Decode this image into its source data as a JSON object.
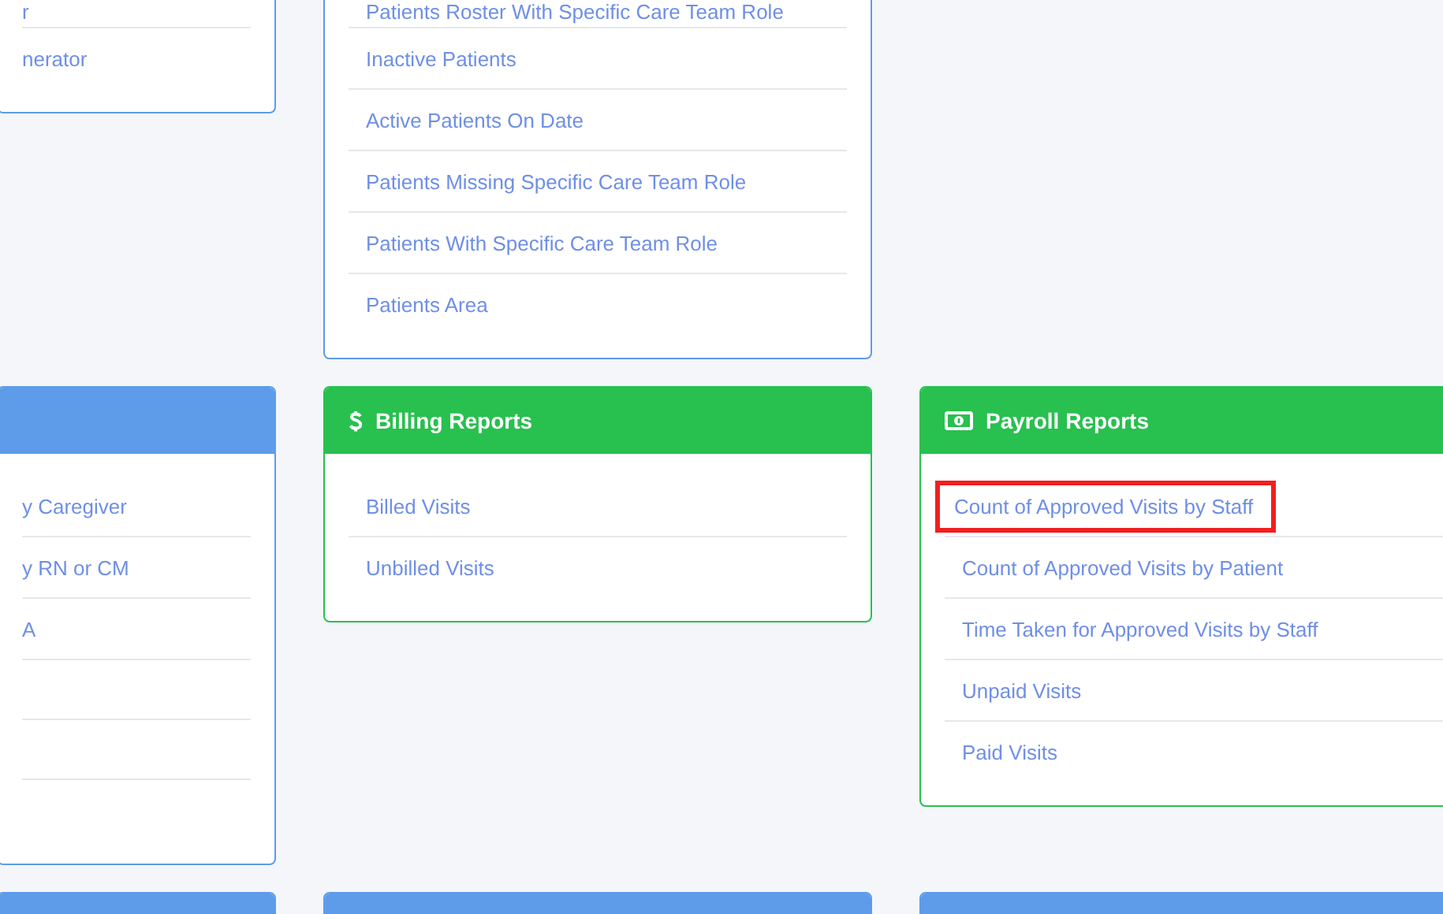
{
  "rows": [
    {
      "cards": [
        {
          "kind": "continued",
          "color": "#5e9cea",
          "items": [
            {
              "label": "r",
              "highlighted": false
            },
            {
              "label": "nerator",
              "highlighted": false
            }
          ]
        },
        {
          "kind": "continued",
          "color": "#5e9cea",
          "items": [
            {
              "label": "Patients Roster With Specific Care Team Role",
              "highlighted": false
            },
            {
              "label": "Inactive Patients",
              "highlighted": false
            },
            {
              "label": "Active Patients On Date",
              "highlighted": false
            },
            {
              "label": "Patients Missing Specific Care Team Role",
              "highlighted": false
            },
            {
              "label": "Patients With Specific Care Team Role",
              "highlighted": false
            },
            {
              "label": "Patients Area",
              "highlighted": false
            }
          ]
        }
      ]
    },
    {
      "cards": [
        {
          "kind": "headed",
          "color": "#5e9cea",
          "items": [
            {
              "label": "y Caregiver",
              "highlighted": false
            },
            {
              "label": "y RN or CM",
              "highlighted": false
            },
            {
              "label": "A",
              "highlighted": false
            },
            {
              "highlighted": false
            },
            {
              "highlighted": false
            },
            {
              "highlighted": false
            }
          ]
        },
        {
          "kind": "headed",
          "color": "#28c04f",
          "header": {
            "title": "Billing Reports",
            "kind": "dollar"
          },
          "items": [
            {
              "label": "Billed Visits",
              "highlighted": false
            },
            {
              "label": "Unbilled Visits",
              "highlighted": false
            }
          ]
        },
        {
          "kind": "headed",
          "color": "#28c04f",
          "header": {
            "title": "Payroll Reports",
            "kind": "banknote"
          },
          "items": [
            {
              "label": "Count of Approved Visits by Staff",
              "highlighted": true
            },
            {
              "label": "Count of Approved Visits by Patient",
              "highlighted": false
            },
            {
              "label": "Time Taken for Approved Visits by Staff",
              "highlighted": false
            },
            {
              "label": "Unpaid Visits",
              "highlighted": false
            },
            {
              "label": "Paid Visits",
              "highlighted": false
            }
          ]
        }
      ]
    },
    {
      "cards": [
        {
          "kind": "headed",
          "color": "#5e9cea"
        },
        {
          "kind": "headed",
          "color": "#5e9cea"
        },
        {
          "kind": "headed",
          "color": "#5e9cea"
        }
      ]
    }
  ]
}
